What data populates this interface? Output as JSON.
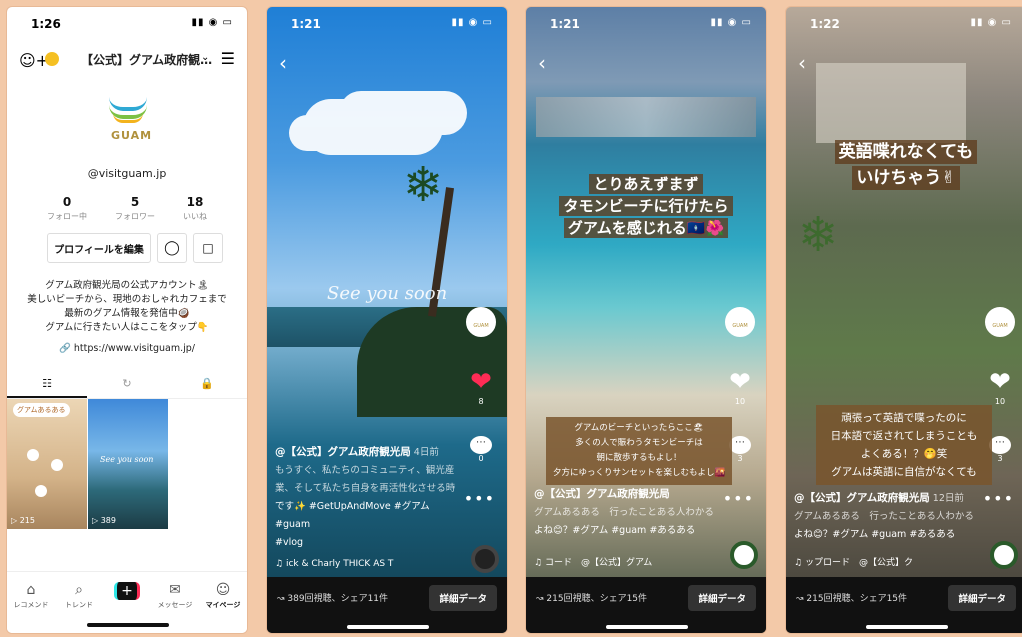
{
  "profile": {
    "time": "1:26",
    "status_icons": "■■ ▽",
    "account_title": "【公式】グアム政府観…",
    "logo_text": "GUAM",
    "handle": "@visitguam.jp",
    "stats": [
      {
        "value": "0",
        "label": "フォロー中"
      },
      {
        "value": "5",
        "label": "フォロワー"
      },
      {
        "value": "18",
        "label": "いいね"
      }
    ],
    "edit_profile": "プロフィールを編集",
    "bio_lines": [
      "グアム政府観光局の公式アカウント🏝",
      "美しいビーチから、現地のおしゃれカフェまで",
      "最新のグアム情報を発信中🥥",
      "グアムに行きたい人はここをタップ👇"
    ],
    "link": "https://www.visitguam.jp/",
    "thumbs": [
      {
        "tag": "グアムあるある",
        "count": "215"
      },
      {
        "tag": "",
        "count": "389",
        "overlay": "See you soon"
      }
    ],
    "nav": [
      {
        "icon": "⌂",
        "label": "レコメンド"
      },
      {
        "icon": "⌕",
        "label": "トレンド"
      },
      {
        "icon": "+",
        "label": ""
      },
      {
        "icon": "✉",
        "label": "メッセージ"
      },
      {
        "icon": "☺",
        "label": "マイページ"
      }
    ]
  },
  "video1": {
    "time": "1:21",
    "overlay": "See you soon",
    "like_count": "8",
    "comment_count": "0",
    "author": "@【公式】グアム政府観光局",
    "ago": "4日前",
    "caption_lines": [
      "もうすぐ、私たちのコミュニティ、観光産",
      "業、そして私たち自身を再活性化させる時",
      "です✨ #GetUpAndMove #グアム #guam",
      "#vlog"
    ],
    "music": "ick & Charly   THICK AS T",
    "stats": "389回視聴、シェア11件",
    "detail_button": "詳細データ"
  },
  "video2": {
    "time": "1:21",
    "headline_lines": [
      "とりあえずまず",
      "タモンビーチに行けたら",
      "グアムを感じれる🇬🇺🌺"
    ],
    "like_count": "10",
    "comment_count": "3",
    "box_lines": [
      "グアムのビーチといったらここ🏖",
      "多くの人で賑わうタモンビーチは",
      "朝に散歩するもよし！",
      "夕方にゆっくりサンセットを楽しむもよし🌇"
    ],
    "author": "@【公式】グアム政府観光局",
    "caption_lines": [
      "グアムあるある　行ったことある人わかる",
      "よね😊？#グアム #guam #あるある"
    ],
    "music": "コード　@【公式】グアム",
    "stats": "215回視聴、シェア15件",
    "detail_button": "詳細データ"
  },
  "video3": {
    "time": "1:22",
    "headline_lines": [
      "英語喋れなくても",
      "いけちゃう✌"
    ],
    "like_count": "10",
    "comment_count": "3",
    "box_lines": [
      "頑張って英語で喋ったのに",
      "日本語で返されてしまうことも",
      "よくある！？🤭笑",
      "グアムは英語に自信がなくても"
    ],
    "author": "@【公式】グアム政府観光局",
    "ago": "12日前",
    "caption_lines": [
      "グアムあるある　行ったことある人わかる",
      "よね😊？#グアム #guam #あるある"
    ],
    "music": "ップロード　@【公式】ク",
    "stats": "215回視聴、シェア15件",
    "detail_button": "詳細データ"
  }
}
